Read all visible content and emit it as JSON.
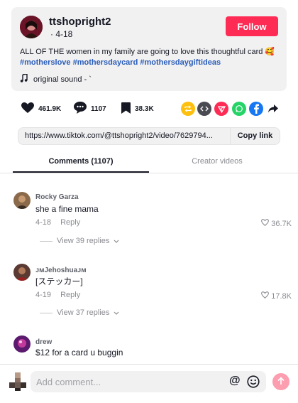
{
  "post": {
    "author": "ttshopright2",
    "date": "· 4-18",
    "follow_label": "Follow",
    "caption_text": "ALL OF THE women in my family are going to love this thoughtful card 🥰",
    "hashtags": [
      "#motherslove",
      "#mothersdaycard",
      "#mothersdaygiftideas"
    ],
    "sound": "original sound - `"
  },
  "actions": {
    "likes": "461.9K",
    "comments": "1107",
    "saves": "38.3K",
    "share_icons": [
      "repost-icon",
      "embed-icon",
      "send-icon",
      "whatsapp-icon",
      "facebook-icon",
      "share-arrow-icon"
    ]
  },
  "link": {
    "url": "https://www.tiktok.com/@ttshopright2/video/7629794...",
    "copy_label": "Copy link"
  },
  "tabs": {
    "comments": "Comments (1107)",
    "creator": "Creator videos"
  },
  "comments": [
    {
      "user": "Rocky Garza",
      "text": "she a fine mama",
      "date": "4-18",
      "reply": "Reply",
      "likes": "36.7K",
      "view_replies": "View 39 replies"
    },
    {
      "user": "ᴊᴍJehoshuaᴊᴍ",
      "text": "[ステッカー]",
      "date": "4-19",
      "reply": "Reply",
      "likes": "17.8K",
      "view_replies": "View 37 replies"
    },
    {
      "user": "drew",
      "text": "$12 for a card u buggin"
    }
  ],
  "composer": {
    "placeholder": "Add comment...",
    "at_symbol": "@"
  },
  "colors": {
    "follow": "#fe2c55",
    "hashtag": "#2b5db9",
    "post_button": "#fd9db0"
  }
}
